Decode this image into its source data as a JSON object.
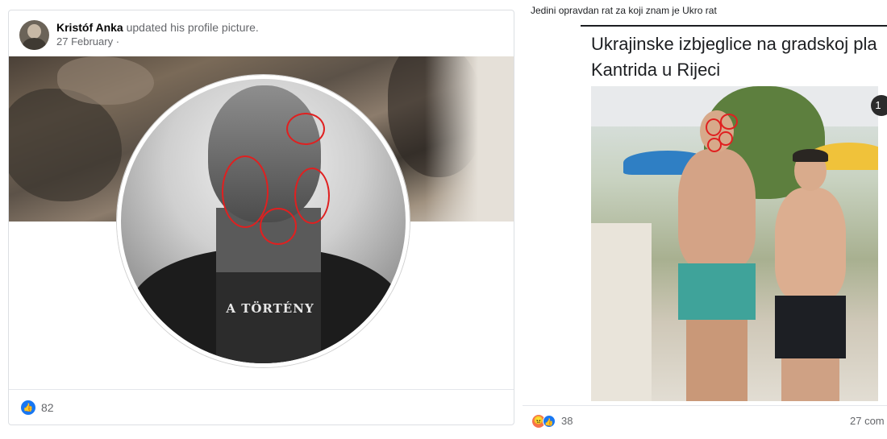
{
  "left_post": {
    "author_name": "Kristóf Anka",
    "action_text": "updated his profile picture.",
    "date": "27 February ·",
    "shirt_print": "A TÖRTÉNY",
    "reaction_count": "82",
    "reaction_icon": "like-icon"
  },
  "right_post": {
    "caption": "Jedini opravdan rat za koji znam je Ukro rat",
    "headline": "Ukrajinske izbjeglice na gradskoj pla\nKantrida u Rijeci",
    "page_badge": "1",
    "reaction_count": "38",
    "reaction_icons": [
      "angry-icon",
      "like-icon"
    ],
    "comments_text": "27 com"
  },
  "colors": {
    "highlight_circle": "#e02020",
    "facebook_blue": "#1877f2",
    "angry_orange": "#f7714c",
    "secondary_text": "#65676b"
  }
}
